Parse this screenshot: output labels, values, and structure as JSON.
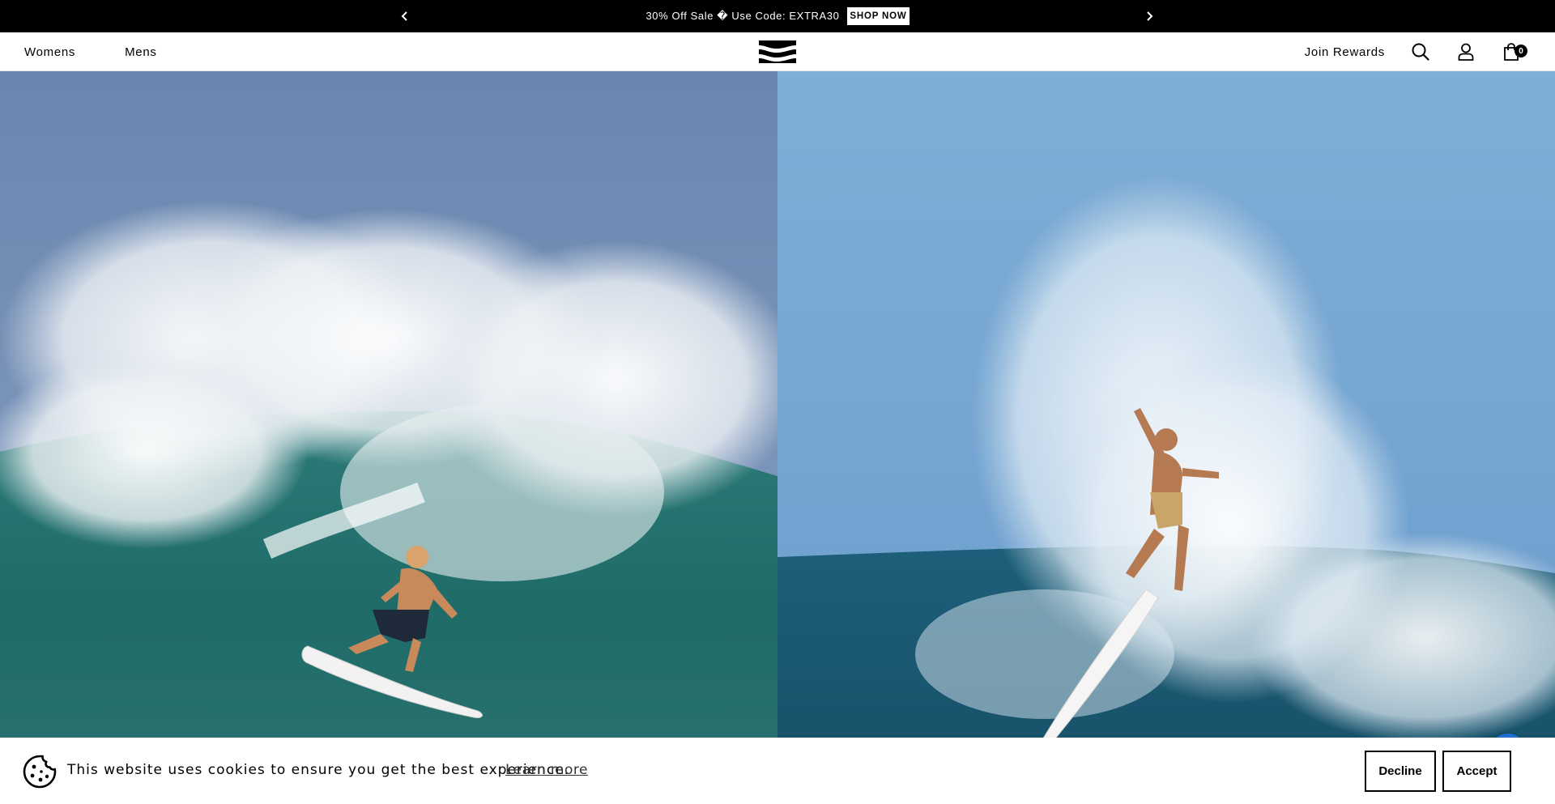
{
  "announcement": {
    "message": "30% Off Sale � Use Code: EXTRA30",
    "cta": "SHOP NOW",
    "prev_icon": "chevron-left-icon",
    "next_icon": "chevron-right-icon"
  },
  "header": {
    "nav": [
      {
        "label": "Womens"
      },
      {
        "label": "Mens"
      }
    ],
    "logo_icon": "billabong-logo-icon",
    "rewards_label": "Join Rewards",
    "icons": [
      "search-icon",
      "account-icon",
      "cart-icon"
    ],
    "cart_count": "0"
  },
  "hero": {
    "panels": [
      {
        "subject": "mens-surf-image"
      },
      {
        "subject": "womens-surf-image"
      }
    ]
  },
  "cookie_banner": {
    "message": "This website uses cookies to ensure you get the best experience.",
    "learn_more": "Learn more",
    "decline": "Decline",
    "accept": "Accept",
    "close_icon": "close-icon",
    "cookie_icon": "cookie-icon"
  },
  "colors": {
    "announcement_bg": "#000000",
    "chat_bubble": "#1d6fd1"
  }
}
